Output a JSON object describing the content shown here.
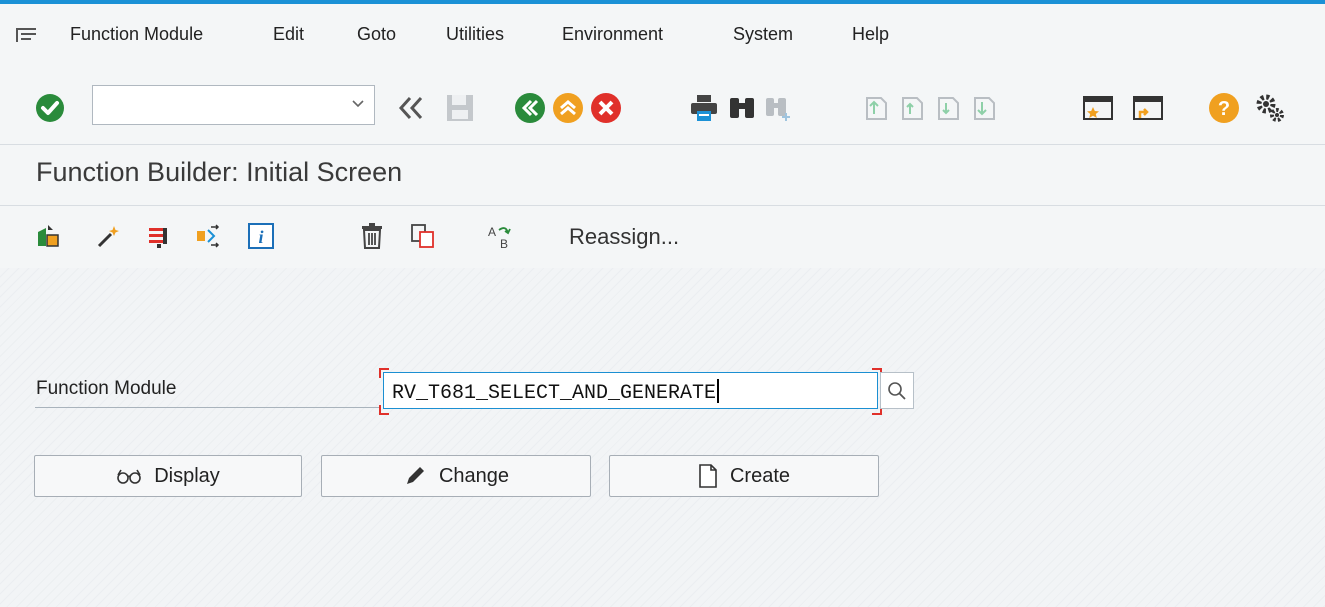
{
  "menu": {
    "items": [
      "Function Module",
      "Edit",
      "Goto",
      "Utilities",
      "Environment",
      "System",
      "Help"
    ]
  },
  "toolbar": {
    "command_value": "",
    "icons": [
      "enter-icon",
      "command-dropdown-icon",
      "collapse-icon",
      "save-icon",
      "back-icon",
      "exit-icon",
      "cancel-icon",
      "print-icon",
      "find-icon",
      "find-next-icon",
      "first-page-icon",
      "previous-page-icon",
      "next-page-icon",
      "last-page-icon",
      "create-session-icon",
      "generate-shortcut-icon",
      "help-icon",
      "settings-icon"
    ]
  },
  "title": "Function Builder: Initial Screen",
  "app_toolbar": {
    "reassign_label": "Reassign..."
  },
  "form": {
    "label": "Function Module",
    "value": "RV_T681_SELECT_AND_GENERATE"
  },
  "buttons": {
    "display": "Display",
    "change": "Change",
    "create": "Create"
  },
  "colors": {
    "accent_blue": "#1b91d6",
    "ok_green": "#2a8b3b",
    "warn_orange": "#f0a020",
    "cancel_red": "#e0302a"
  }
}
